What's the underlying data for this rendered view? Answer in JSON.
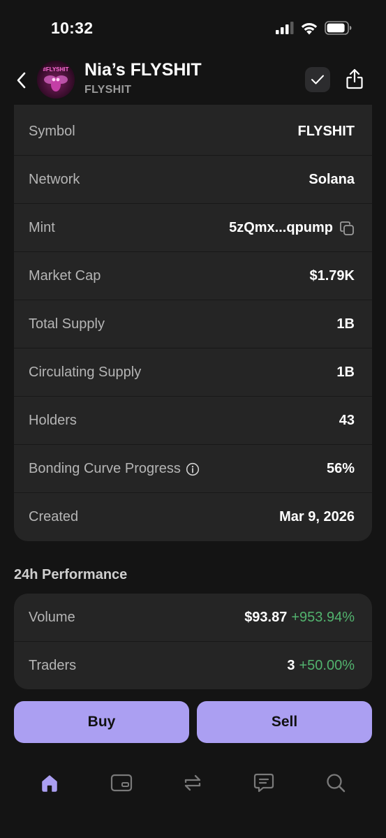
{
  "status_bar": {
    "time": "10:32"
  },
  "header": {
    "token_name": "Nia’s FLYSHIT",
    "token_ticker": "FLYSHIT",
    "avatar_text": "#FLYSHIT"
  },
  "token_info": {
    "rows": [
      {
        "label": "Symbol",
        "value": "FLYSHIT"
      },
      {
        "label": "Network",
        "value": "Solana"
      },
      {
        "label": "Mint",
        "value": "5zQmx...qpump"
      },
      {
        "label": "Market Cap",
        "value": "$1.79K"
      },
      {
        "label": "Total Supply",
        "value": "1B"
      },
      {
        "label": "Circulating Supply",
        "value": "1B"
      },
      {
        "label": "Holders",
        "value": "43"
      },
      {
        "label": "Bonding Curve Progress",
        "value": "56%"
      },
      {
        "label": "Created",
        "value": "Mar 9, 2026"
      }
    ]
  },
  "performance": {
    "title": "24h Performance",
    "rows": [
      {
        "label": "Volume",
        "value": "$93.87",
        "change": "+953.94%"
      },
      {
        "label": "Traders",
        "value": "3",
        "change": "+50.00%"
      }
    ]
  },
  "actions": {
    "buy_label": "Buy",
    "sell_label": "Sell"
  },
  "tab_bar": {
    "tabs": [
      "home-icon",
      "wallet-card-icon",
      "swap-icon",
      "chat-icon",
      "search-icon"
    ],
    "active": "home-icon"
  },
  "colors": {
    "accent": "#ab9ff2",
    "positive": "#52b36e",
    "card": "#252525",
    "background": "#141414"
  }
}
